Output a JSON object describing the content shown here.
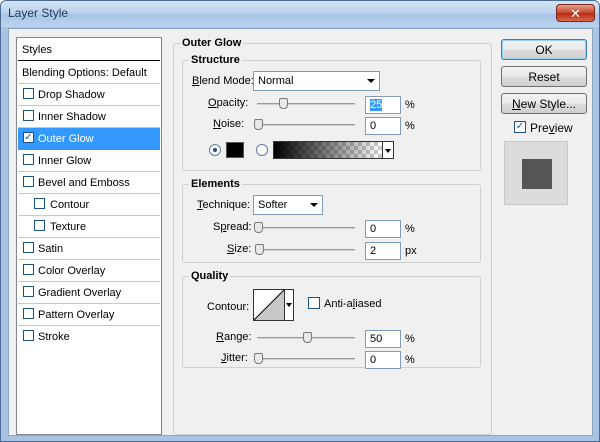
{
  "window": {
    "title": "Layer Style",
    "close_glyph": "✕"
  },
  "styles_list": {
    "header": "Styles",
    "items": [
      {
        "label": "Blending Options: Default",
        "has_checkbox": false,
        "checked": false
      },
      {
        "label": "Drop Shadow",
        "has_checkbox": true,
        "checked": false
      },
      {
        "label": "Inner Shadow",
        "has_checkbox": true,
        "checked": false
      },
      {
        "label": "Outer Glow",
        "has_checkbox": true,
        "checked": true,
        "selected": true
      },
      {
        "label": "Inner Glow",
        "has_checkbox": true,
        "checked": false
      },
      {
        "label": "Bevel and Emboss",
        "has_checkbox": true,
        "checked": false
      },
      {
        "label": "Contour",
        "has_checkbox": true,
        "checked": false,
        "indent": true
      },
      {
        "label": "Texture",
        "has_checkbox": true,
        "checked": false,
        "indent": true
      },
      {
        "label": "Satin",
        "has_checkbox": true,
        "checked": false
      },
      {
        "label": "Color Overlay",
        "has_checkbox": true,
        "checked": false
      },
      {
        "label": "Gradient Overlay",
        "has_checkbox": true,
        "checked": false
      },
      {
        "label": "Pattern Overlay",
        "has_checkbox": true,
        "checked": false
      },
      {
        "label": "Stroke",
        "has_checkbox": true,
        "checked": false
      }
    ]
  },
  "outer_glow": {
    "title": "Outer Glow",
    "structure": {
      "title": "Structure",
      "blend_mode_label_pre": "",
      "blend_mode_label_u": "B",
      "blend_mode_label_post": "lend Mode:",
      "blend_mode_value": "Normal",
      "opacity_label_u": "O",
      "opacity_label_post": "pacity:",
      "opacity_value": "25",
      "opacity_unit": "%",
      "noise_label_u": "N",
      "noise_label_post": "oise:",
      "noise_value": "0",
      "noise_unit": "%",
      "color_fill": "#000000"
    },
    "elements": {
      "title": "Elements",
      "technique_label_u": "T",
      "technique_label_post": "echnique:",
      "technique_value": "Softer",
      "spread_label_pre": "S",
      "spread_label_u": "p",
      "spread_label_post": "read:",
      "spread_value": "0",
      "spread_unit": "%",
      "size_label_u": "S",
      "size_label_post": "ize:",
      "size_value": "2",
      "size_unit": "px"
    },
    "quality": {
      "title": "Quality",
      "contour_label": "Contour:",
      "anti_aliased_pre": "Anti-a",
      "anti_aliased_u": "l",
      "anti_aliased_post": "iased",
      "anti_aliased_checked": false,
      "range_label_u": "R",
      "range_label_post": "ange:",
      "range_value": "50",
      "range_unit": "%",
      "jitter_label_u": "J",
      "jitter_label_post": "itter:",
      "jitter_value": "0",
      "jitter_unit": "%"
    }
  },
  "buttons": {
    "ok": "OK",
    "reset": "Reset",
    "new_style_u": "N",
    "new_style_post": "ew Style...",
    "preview_label_pre": "Pre",
    "preview_label_u": "v",
    "preview_label_post": "iew",
    "preview_checked": true
  },
  "colors": {
    "selection": "#3399ff",
    "preview_square": "#555555",
    "preview_bg": "#dcdcdc"
  }
}
